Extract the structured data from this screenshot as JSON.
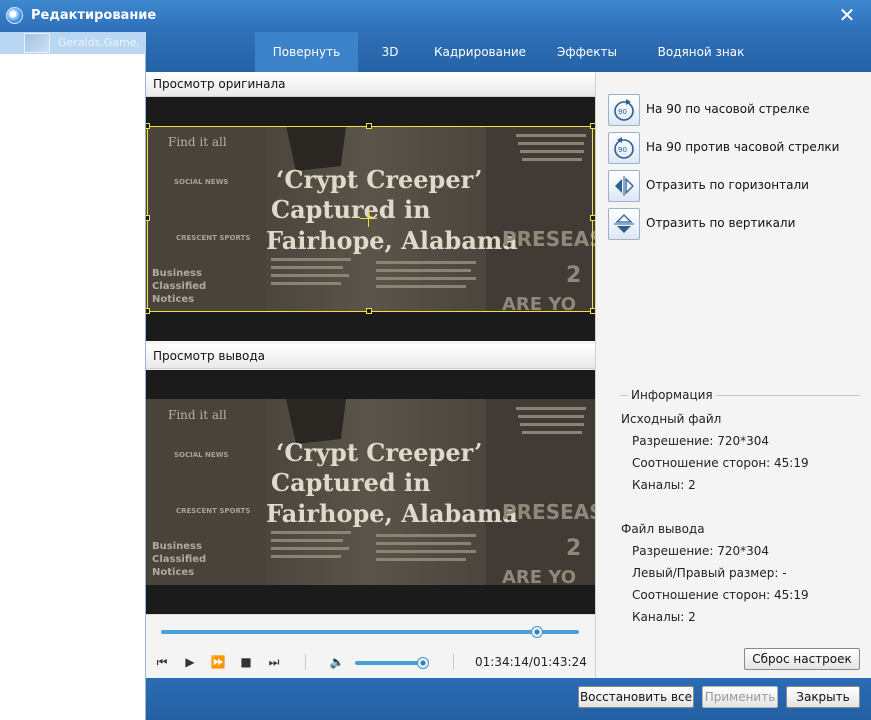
{
  "window": {
    "title": "Редактирование",
    "app_icon": "app-logo-icon",
    "close_icon": "close-icon"
  },
  "sidebar": {
    "items": [
      {
        "label": "Geralds.Game.",
        "selected": true
      }
    ]
  },
  "tabs": [
    {
      "label": "Повернуть",
      "active": true
    },
    {
      "label": "3D",
      "active": false
    },
    {
      "label": "Кадрирование",
      "active": false
    },
    {
      "label": "Эффекты",
      "active": false
    },
    {
      "label": "Водяной знак",
      "active": false
    }
  ],
  "preview": {
    "original_title": "Просмотр оригинала",
    "output_title": "Просмотр вывода"
  },
  "frame_text": {
    "headline": [
      "‘Crypt Creeper’",
      "Captured in",
      "Fairhope, Alabama"
    ],
    "sidebar_lines": [
      "Find it all",
      "SOCIAL NEWS",
      "CRESCENT SPORTS",
      "Business",
      "Classified",
      "Notices"
    ],
    "right_block": [
      "PRESEASO",
      "2",
      "ARE YO"
    ]
  },
  "playback": {
    "progress": 0.9,
    "volume": 0.94,
    "timecode": "01:34:14/01:43:24",
    "icons": [
      "prev-frame-icon",
      "play-icon",
      "fast-forward-icon",
      "stop-icon",
      "next-frame-icon",
      "volume-icon"
    ]
  },
  "rotate_actions": [
    {
      "label": "На 90 по часовой стрелке",
      "icon": "rotate-clockwise-icon"
    },
    {
      "label": "На 90 против часовой стрелки",
      "icon": "rotate-counterclockwise-icon"
    },
    {
      "label": "Отразить по горизонтали",
      "icon": "flip-horizontal-icon"
    },
    {
      "label": "Отразить по вертикали",
      "icon": "flip-vertical-icon"
    }
  ],
  "info": {
    "legend": "Информация",
    "source_heading": "Исходный файл",
    "source_resolution": "Разрешение: 720*304",
    "source_aspect": "Соотношение сторон: 45:19",
    "source_channels": "Каналы: 2",
    "output_heading": "Файл вывода",
    "output_resolution": "Разрешение: 720*304",
    "output_lr_size": "Левый/Правый размер: -",
    "output_aspect": "Соотношение сторон: 45:19",
    "output_channels": "Каналы: 2",
    "rotate_label": "90"
  },
  "buttons": {
    "reset": "Сброс настроек",
    "restore_all": "Восстановить все",
    "apply": "Применить",
    "close": "Закрыть"
  },
  "colors": {
    "accent": "#2d6fb8",
    "crop_frame": "#f0e040",
    "slider": "#4a9fd6"
  }
}
